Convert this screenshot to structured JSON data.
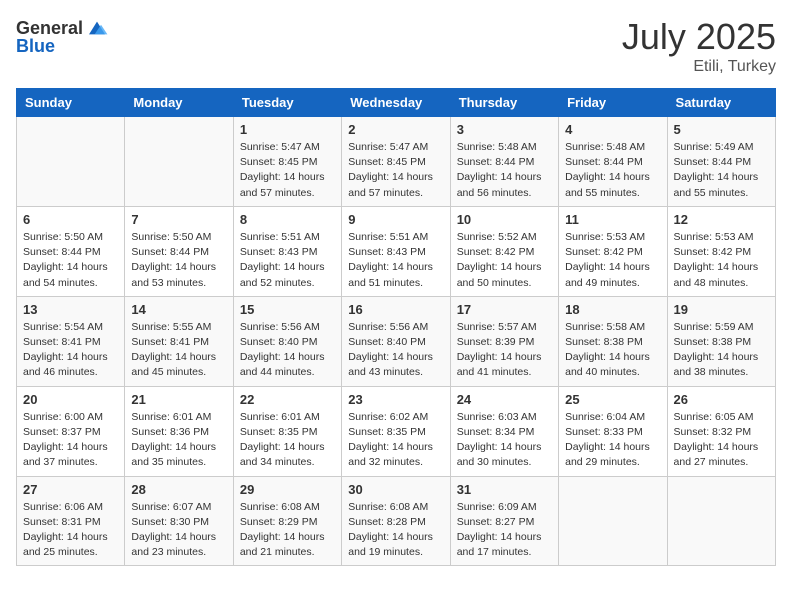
{
  "header": {
    "logo_general": "General",
    "logo_blue": "Blue",
    "month": "July 2025",
    "location": "Etili, Turkey"
  },
  "days_of_week": [
    "Sunday",
    "Monday",
    "Tuesday",
    "Wednesday",
    "Thursday",
    "Friday",
    "Saturday"
  ],
  "weeks": [
    [
      {
        "day": "",
        "content": ""
      },
      {
        "day": "",
        "content": ""
      },
      {
        "day": "1",
        "content": "Sunrise: 5:47 AM\nSunset: 8:45 PM\nDaylight: 14 hours and 57 minutes."
      },
      {
        "day": "2",
        "content": "Sunrise: 5:47 AM\nSunset: 8:45 PM\nDaylight: 14 hours and 57 minutes."
      },
      {
        "day": "3",
        "content": "Sunrise: 5:48 AM\nSunset: 8:44 PM\nDaylight: 14 hours and 56 minutes."
      },
      {
        "day": "4",
        "content": "Sunrise: 5:48 AM\nSunset: 8:44 PM\nDaylight: 14 hours and 55 minutes."
      },
      {
        "day": "5",
        "content": "Sunrise: 5:49 AM\nSunset: 8:44 PM\nDaylight: 14 hours and 55 minutes."
      }
    ],
    [
      {
        "day": "6",
        "content": "Sunrise: 5:50 AM\nSunset: 8:44 PM\nDaylight: 14 hours and 54 minutes."
      },
      {
        "day": "7",
        "content": "Sunrise: 5:50 AM\nSunset: 8:44 PM\nDaylight: 14 hours and 53 minutes."
      },
      {
        "day": "8",
        "content": "Sunrise: 5:51 AM\nSunset: 8:43 PM\nDaylight: 14 hours and 52 minutes."
      },
      {
        "day": "9",
        "content": "Sunrise: 5:51 AM\nSunset: 8:43 PM\nDaylight: 14 hours and 51 minutes."
      },
      {
        "day": "10",
        "content": "Sunrise: 5:52 AM\nSunset: 8:42 PM\nDaylight: 14 hours and 50 minutes."
      },
      {
        "day": "11",
        "content": "Sunrise: 5:53 AM\nSunset: 8:42 PM\nDaylight: 14 hours and 49 minutes."
      },
      {
        "day": "12",
        "content": "Sunrise: 5:53 AM\nSunset: 8:42 PM\nDaylight: 14 hours and 48 minutes."
      }
    ],
    [
      {
        "day": "13",
        "content": "Sunrise: 5:54 AM\nSunset: 8:41 PM\nDaylight: 14 hours and 46 minutes."
      },
      {
        "day": "14",
        "content": "Sunrise: 5:55 AM\nSunset: 8:41 PM\nDaylight: 14 hours and 45 minutes."
      },
      {
        "day": "15",
        "content": "Sunrise: 5:56 AM\nSunset: 8:40 PM\nDaylight: 14 hours and 44 minutes."
      },
      {
        "day": "16",
        "content": "Sunrise: 5:56 AM\nSunset: 8:40 PM\nDaylight: 14 hours and 43 minutes."
      },
      {
        "day": "17",
        "content": "Sunrise: 5:57 AM\nSunset: 8:39 PM\nDaylight: 14 hours and 41 minutes."
      },
      {
        "day": "18",
        "content": "Sunrise: 5:58 AM\nSunset: 8:38 PM\nDaylight: 14 hours and 40 minutes."
      },
      {
        "day": "19",
        "content": "Sunrise: 5:59 AM\nSunset: 8:38 PM\nDaylight: 14 hours and 38 minutes."
      }
    ],
    [
      {
        "day": "20",
        "content": "Sunrise: 6:00 AM\nSunset: 8:37 PM\nDaylight: 14 hours and 37 minutes."
      },
      {
        "day": "21",
        "content": "Sunrise: 6:01 AM\nSunset: 8:36 PM\nDaylight: 14 hours and 35 minutes."
      },
      {
        "day": "22",
        "content": "Sunrise: 6:01 AM\nSunset: 8:35 PM\nDaylight: 14 hours and 34 minutes."
      },
      {
        "day": "23",
        "content": "Sunrise: 6:02 AM\nSunset: 8:35 PM\nDaylight: 14 hours and 32 minutes."
      },
      {
        "day": "24",
        "content": "Sunrise: 6:03 AM\nSunset: 8:34 PM\nDaylight: 14 hours and 30 minutes."
      },
      {
        "day": "25",
        "content": "Sunrise: 6:04 AM\nSunset: 8:33 PM\nDaylight: 14 hours and 29 minutes."
      },
      {
        "day": "26",
        "content": "Sunrise: 6:05 AM\nSunset: 8:32 PM\nDaylight: 14 hours and 27 minutes."
      }
    ],
    [
      {
        "day": "27",
        "content": "Sunrise: 6:06 AM\nSunset: 8:31 PM\nDaylight: 14 hours and 25 minutes."
      },
      {
        "day": "28",
        "content": "Sunrise: 6:07 AM\nSunset: 8:30 PM\nDaylight: 14 hours and 23 minutes."
      },
      {
        "day": "29",
        "content": "Sunrise: 6:08 AM\nSunset: 8:29 PM\nDaylight: 14 hours and 21 minutes."
      },
      {
        "day": "30",
        "content": "Sunrise: 6:08 AM\nSunset: 8:28 PM\nDaylight: 14 hours and 19 minutes."
      },
      {
        "day": "31",
        "content": "Sunrise: 6:09 AM\nSunset: 8:27 PM\nDaylight: 14 hours and 17 minutes."
      },
      {
        "day": "",
        "content": ""
      },
      {
        "day": "",
        "content": ""
      }
    ]
  ]
}
